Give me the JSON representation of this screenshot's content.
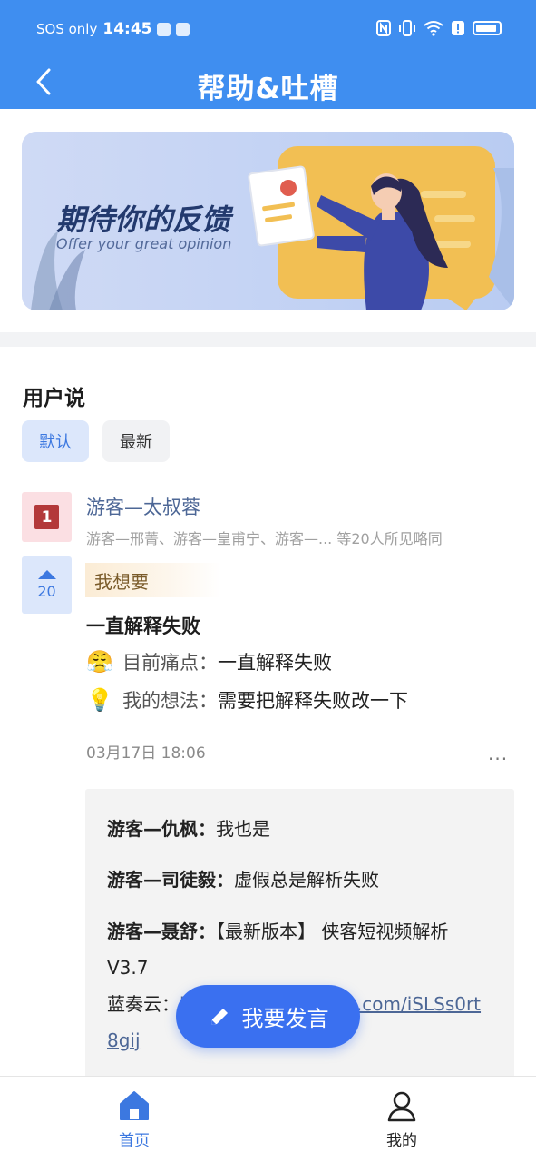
{
  "status_bar": {
    "carrier": "SOS only",
    "time": "14:45",
    "icons": [
      "nfc-icon",
      "vibrate-icon",
      "wifi-icon",
      "alert-icon",
      "battery-icon"
    ]
  },
  "nav": {
    "title": "帮助&吐槽",
    "back_icon": "chevron-left-icon"
  },
  "banner": {
    "title": "期待你的反馈",
    "subtitle": "Offer your great opinion"
  },
  "section": {
    "title": "用户说",
    "sort_tabs": [
      {
        "label": "默认",
        "active": true
      },
      {
        "label": "最新",
        "active": false
      }
    ]
  },
  "post": {
    "rank": "1",
    "votes": "20",
    "author": "游客—太叔蓉",
    "agree_line": "游客—邢菁、游客—皇甫宁、游客—... 等20人所见略同",
    "tag": "我想要",
    "title": "一直解释失败",
    "pain_emoji": "😤",
    "pain_label": "目前痛点：",
    "pain_text": "一直解释失败",
    "idea_emoji": "💡",
    "idea_label": "我的想法：",
    "idea_text": "需要把解释失败改一下",
    "timestamp": "03月17日 18:06",
    "more": "..."
  },
  "replies": [
    {
      "who": "游客—仇枫：",
      "text": "我也是"
    },
    {
      "who": "游客—司徒毅：",
      "text": "虚假总是解析失败"
    },
    {
      "who": "游客—聂舒：",
      "text": "【最新版本】 侠客短视频解析V3.7",
      "line2_prefix": "蓝奏云：",
      "link": "https://wwi.lanzoub.com/iSLSs0rt8gij"
    }
  ],
  "fab": {
    "label": "我要发言",
    "icon": "pencil-icon"
  },
  "bottom_nav": [
    {
      "label": "首页",
      "icon": "home-icon",
      "active": true
    },
    {
      "label": "我的",
      "icon": "user-icon",
      "active": false
    }
  ],
  "colors": {
    "primary": "#3f8ef0",
    "accent": "#3a70f0",
    "rank_red": "#b3393a"
  }
}
